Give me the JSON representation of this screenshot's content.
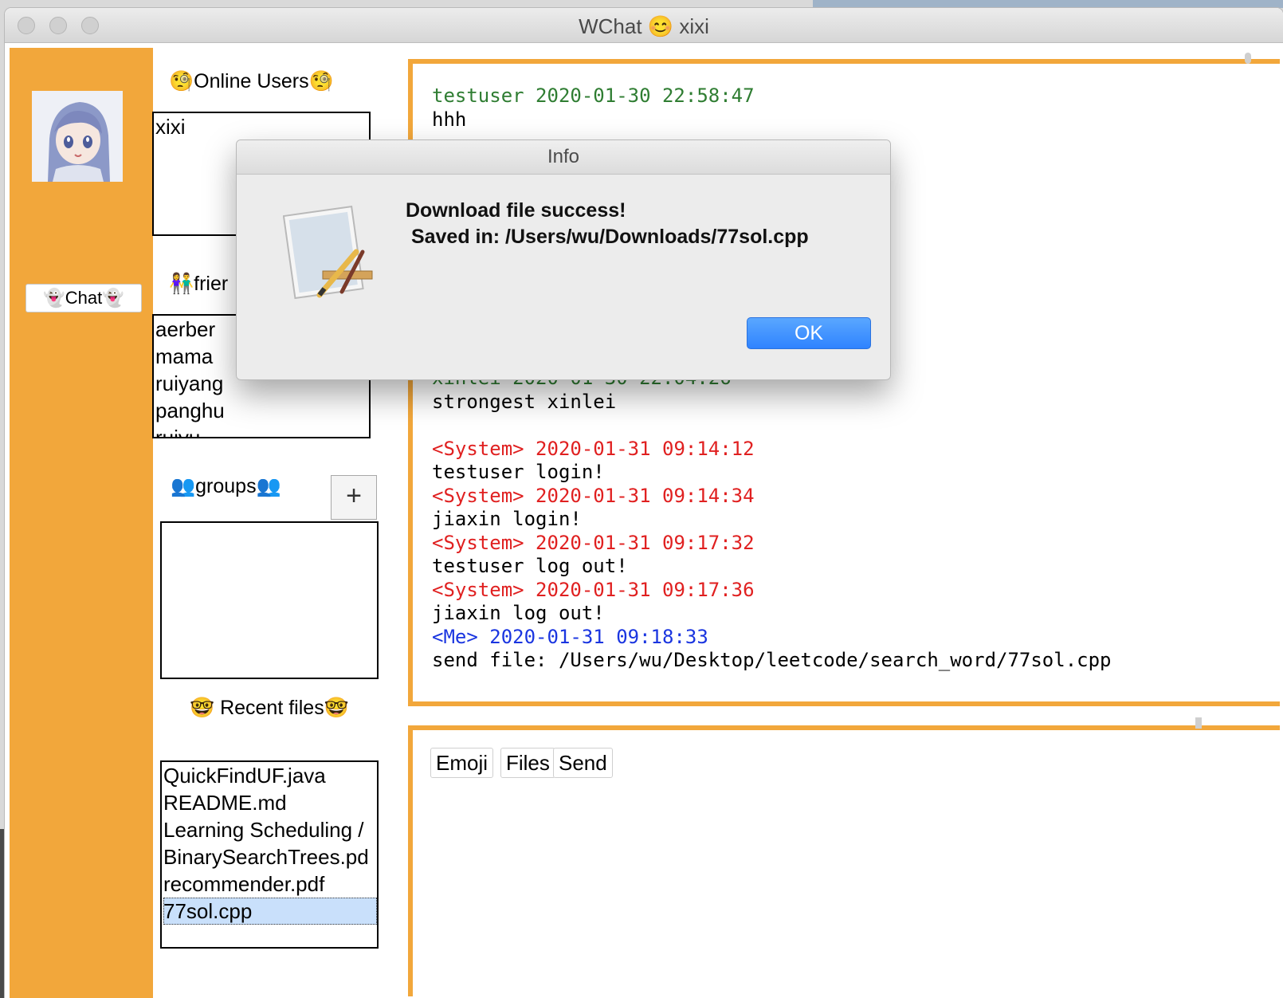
{
  "window": {
    "title": "WChat 😊 xixi"
  },
  "sidebar": {
    "chat_button_label": "👻Chat👻"
  },
  "online_users": {
    "title": "🧐Online Users🧐",
    "items": [
      "xixi"
    ]
  },
  "friends": {
    "title": "👫frier",
    "items": [
      "aerber",
      "mama",
      "ruiyang",
      "panghu",
      "ruiyu"
    ]
  },
  "groups": {
    "title": "👥groups👥",
    "add_label": "+",
    "items": []
  },
  "recent_files": {
    "title": "🤓 Recent files🤓",
    "items": [
      "QuickFindUF.java",
      "README.md",
      "Learning Scheduling /",
      "BinarySearchTrees.pd",
      "recommender.pdf",
      "77sol.cpp"
    ],
    "selected": "77sol.cpp"
  },
  "messages": [
    {
      "kind": "user",
      "header": "testuser 2020-01-30 22:58:47",
      "body": "hhh"
    },
    {
      "kind": "user",
      "header": "xinlei 2020-01-30 22:04:26",
      "body": "strongest xinlei"
    },
    {
      "kind": "system",
      "tag": "<System>",
      "time": "2020-01-31 09:14:12",
      "body": "testuser login!"
    },
    {
      "kind": "system",
      "tag": "<System>",
      "time": "2020-01-31 09:14:34",
      "body": "jiaxin login!"
    },
    {
      "kind": "system",
      "tag": "<System>",
      "time": "2020-01-31 09:17:32",
      "body": "testuser log out!"
    },
    {
      "kind": "system",
      "tag": "<System>",
      "time": "2020-01-31 09:17:36",
      "body": "jiaxin log out!"
    },
    {
      "kind": "me",
      "tag": "<Me>",
      "time": "2020-01-31 09:18:33",
      "body": "send file: /Users/wu/Desktop/leetcode/search_word/77sol.cpp"
    }
  ],
  "input_toolbar": {
    "emoji_label": "Emoji",
    "files_label": "Files",
    "send_label": "Send"
  },
  "dialog": {
    "title": "Info",
    "message": "Download file success!\n Saved in: /Users/wu/Downloads/77sol.cpp",
    "ok_label": "OK",
    "icon": "text-edit-app-icon"
  },
  "colors": {
    "accent": "#f2a73b",
    "user": "#2f7d32",
    "system": "#e02020",
    "me": "#1a35e0",
    "selected_row": "#c9e0fb"
  }
}
